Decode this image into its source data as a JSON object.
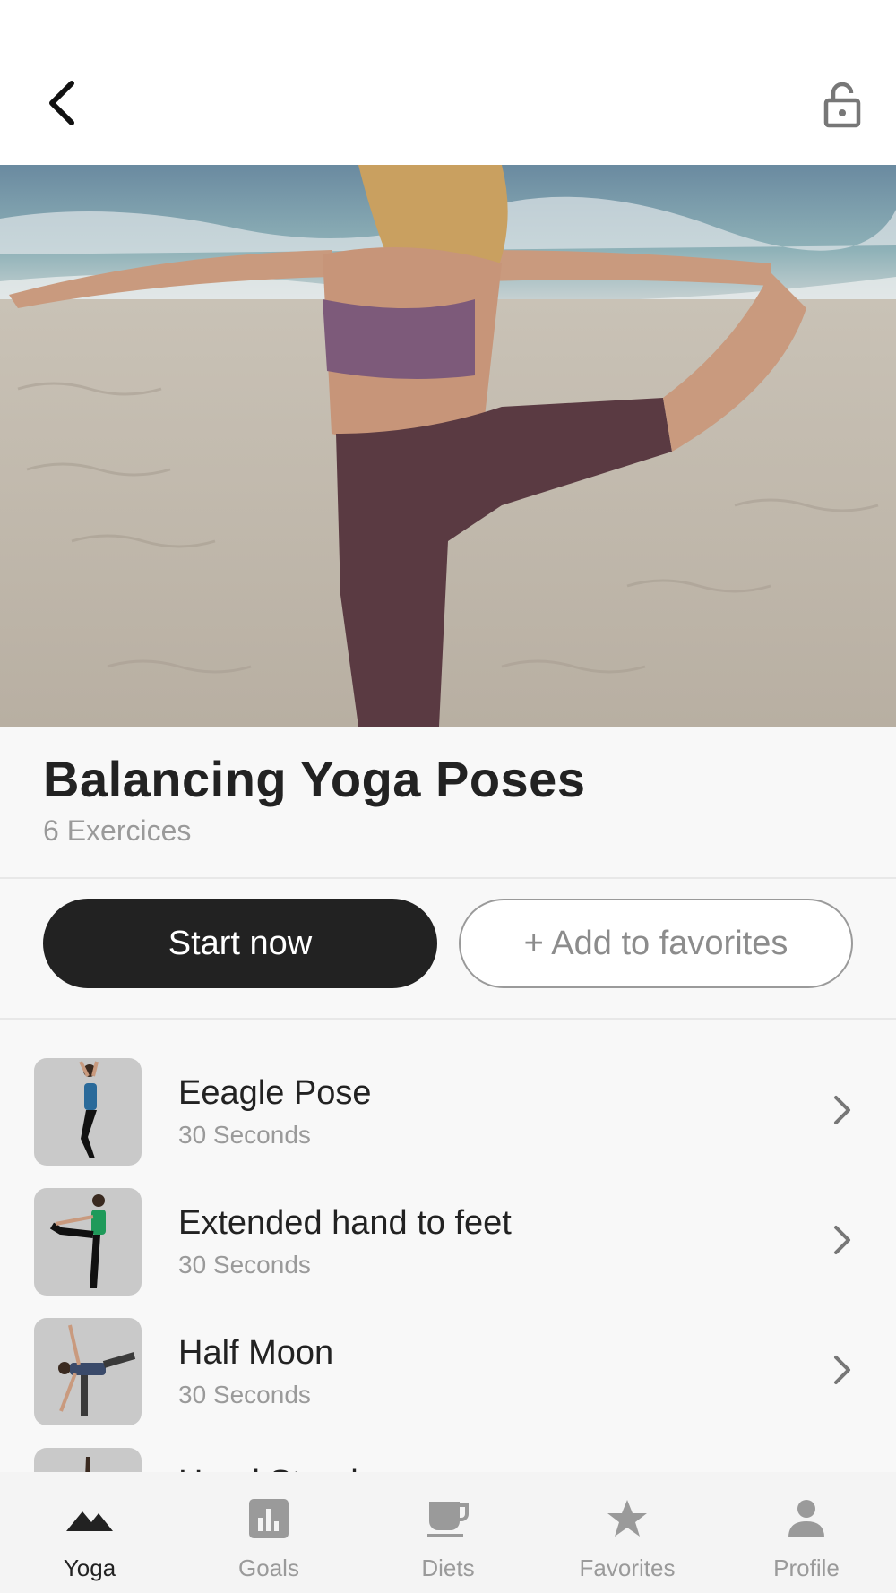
{
  "header": {
    "back_icon": "chevron-left-icon",
    "lock_icon": "lock-icon"
  },
  "hero": {
    "image": "woman-balancing-yoga-pose-on-beach"
  },
  "workout": {
    "title": "Balancing Yoga Poses",
    "count_label": "6 Exercices"
  },
  "actions": {
    "start_label": "Start now",
    "favorite_label": "+ Add to favorites"
  },
  "exercises": [
    {
      "name": "Eeagle Pose",
      "duration": "30 Seconds"
    },
    {
      "name": "Extended hand to feet",
      "duration": "30 Seconds"
    },
    {
      "name": "Half Moon",
      "duration": "30 Seconds"
    },
    {
      "name": "Hand Stand",
      "duration": ""
    }
  ],
  "tabbar": {
    "items": [
      {
        "label": "Yoga",
        "icon": "mountain-icon",
        "active": true
      },
      {
        "label": "Goals",
        "icon": "bar-chart-icon",
        "active": false
      },
      {
        "label": "Diets",
        "icon": "coffee-cup-icon",
        "active": false
      },
      {
        "label": "Favorites",
        "icon": "star-icon",
        "active": false
      },
      {
        "label": "Profile",
        "icon": "person-icon",
        "active": false
      }
    ]
  },
  "colors": {
    "primary": "#222222",
    "muted": "#9a9a9a",
    "background": "#f8f8f8"
  }
}
